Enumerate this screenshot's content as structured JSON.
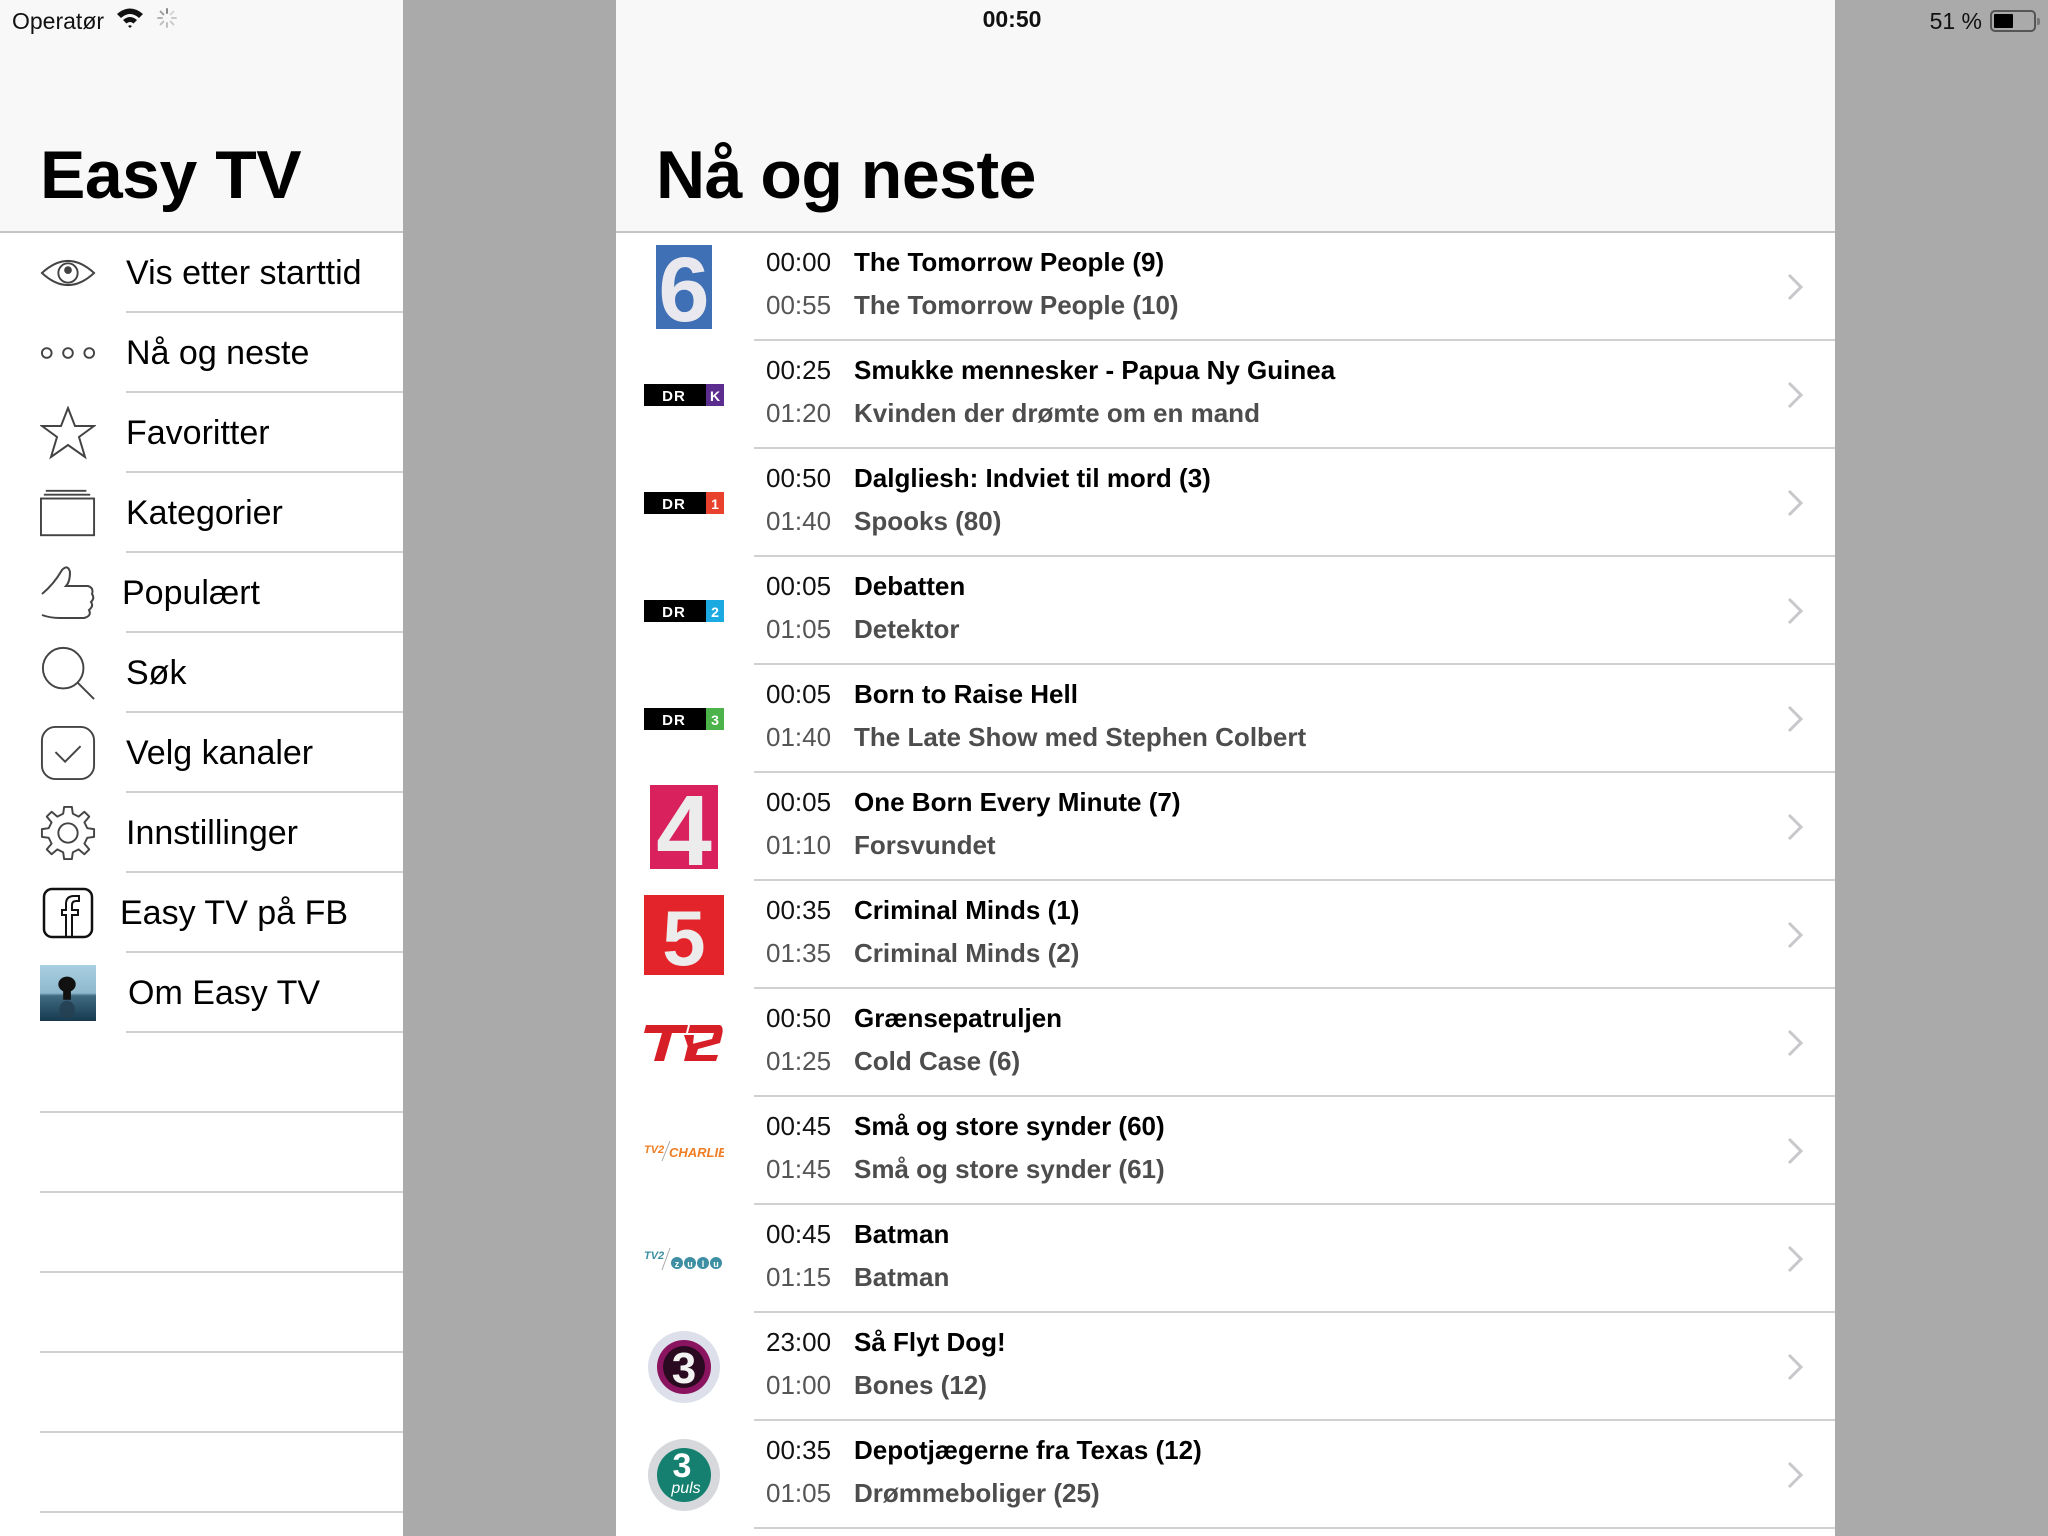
{
  "status_bar": {
    "carrier": "Operatør",
    "time": "00:50",
    "battery_text": "51 %",
    "battery_level": 0.51
  },
  "sidebar": {
    "title": "Easy TV",
    "items": [
      {
        "label": "Vis etter starttid",
        "icon": "eye-icon"
      },
      {
        "label": "Nå og neste",
        "icon": "three-dots-icon"
      },
      {
        "label": "Favoritter",
        "icon": "star-icon"
      },
      {
        "label": "Kategorier",
        "icon": "folder-stack-icon"
      },
      {
        "label": "Populært",
        "icon": "thumbs-up-icon"
      },
      {
        "label": "Søk",
        "icon": "search-icon"
      },
      {
        "label": "Velg kanaler",
        "icon": "checkbox-icon"
      },
      {
        "label": "Innstillinger",
        "icon": "gear-icon"
      },
      {
        "label": "Easy TV på FB",
        "icon": "facebook-icon"
      },
      {
        "label": "Om Easy TV",
        "icon": "app-avatar-icon"
      }
    ]
  },
  "main": {
    "title": "Nå og neste",
    "channels": [
      {
        "channel": "Kanal 6",
        "logo": "6",
        "now_time": "00:00",
        "now_title": "The Tomorrow People (9)",
        "next_time": "00:55",
        "next_title": "The Tomorrow People (10)"
      },
      {
        "channel": "DR K",
        "logo": "DR K",
        "now_time": "00:25",
        "now_title": "Smukke mennesker - Papua Ny Guinea",
        "next_time": "01:20",
        "next_title": "Kvinden der drømte om en mand"
      },
      {
        "channel": "DR1",
        "logo": "DR 1",
        "now_time": "00:50",
        "now_title": "Dalgliesh: Indviet til mord (3)",
        "next_time": "01:40",
        "next_title": "Spooks (80)"
      },
      {
        "channel": "DR2",
        "logo": "DR 2",
        "now_time": "00:05",
        "now_title": "Debatten",
        "next_time": "01:05",
        "next_title": "Detektor"
      },
      {
        "channel": "DR3",
        "logo": "DR 3",
        "now_time": "00:05",
        "now_title": "Born to Raise Hell",
        "next_time": "01:40",
        "next_title": "The Late Show med Stephen Colbert"
      },
      {
        "channel": "Kanal 4",
        "logo": "4",
        "now_time": "00:05",
        "now_title": "One Born Every Minute (7)",
        "next_time": "01:10",
        "next_title": "Forsvundet"
      },
      {
        "channel": "Kanal 5",
        "logo": "5",
        "now_time": "00:35",
        "now_title": "Criminal Minds (1)",
        "next_time": "01:35",
        "next_title": "Criminal Minds (2)"
      },
      {
        "channel": "TV 2",
        "logo": "TV2",
        "now_time": "00:50",
        "now_title": "Grænsepatruljen",
        "next_time": "01:25",
        "next_title": "Cold Case (6)"
      },
      {
        "channel": "TV 2 Charlie",
        "logo": "CHARLIE",
        "now_time": "00:45",
        "now_title": "Små og store synder (60)",
        "next_time": "01:45",
        "next_title": "Små og store synder (61)"
      },
      {
        "channel": "TV 2 Zulu",
        "logo": "ZULU",
        "now_time": "00:45",
        "now_title": "Batman",
        "next_time": "01:15",
        "next_title": "Batman"
      },
      {
        "channel": "TV3",
        "logo": "3",
        "now_time": "23:00",
        "now_title": "Så Flyt Dog!",
        "next_time": "01:00",
        "next_title": "Bones (12)"
      },
      {
        "channel": "TV3 Puls",
        "logo": "3 puls",
        "now_time": "00:35",
        "now_title": "Depotjægerne fra Texas (12)",
        "next_time": "01:05",
        "next_title": "Drømmeboliger (25)"
      }
    ]
  },
  "colors": {
    "dr_k": "#5b2d8e",
    "dr_1": "#e8412c",
    "dr_2": "#1aa9e0",
    "dr_3": "#4cb34a",
    "kanal6": "#3f6fb5",
    "kanal4": "#d9215e",
    "kanal5": "#e3242b",
    "tv2": "#d71f27",
    "charlie": "#f07d23",
    "zulu": "#3e8fa3"
  }
}
